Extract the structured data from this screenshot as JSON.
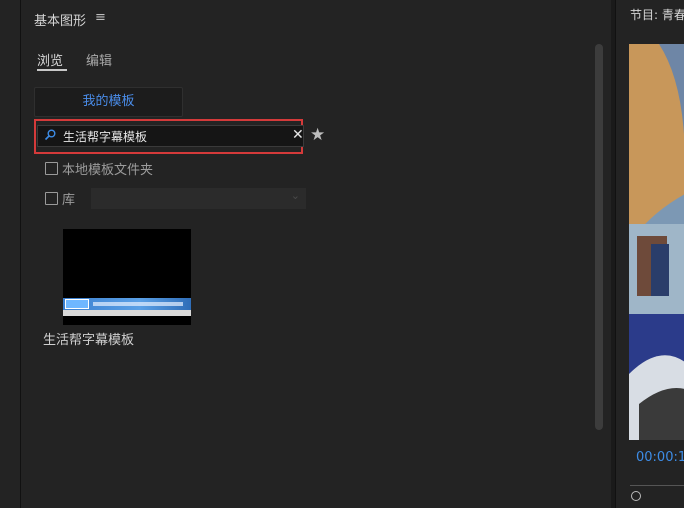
{
  "panel": {
    "title": "基本图形",
    "tabs": [
      {
        "label": "浏览",
        "active": true
      },
      {
        "label": "编辑",
        "active": false
      }
    ],
    "my_templates_label": "我的模板",
    "search": {
      "value": "生活帮字幕模板"
    },
    "local_templates_label": "本地模板文件夹",
    "library_label": "库",
    "template": {
      "label": "生活帮字幕模板"
    }
  },
  "program": {
    "title": "节目: 青春",
    "timecode": "00:00:1"
  },
  "colors": {
    "accent": "#3d8ce6",
    "highlight_box": "#d43a3a"
  },
  "icons": [
    "menu-icon",
    "search-icon",
    "clear-icon",
    "star-icon",
    "chevron-down-icon"
  ]
}
